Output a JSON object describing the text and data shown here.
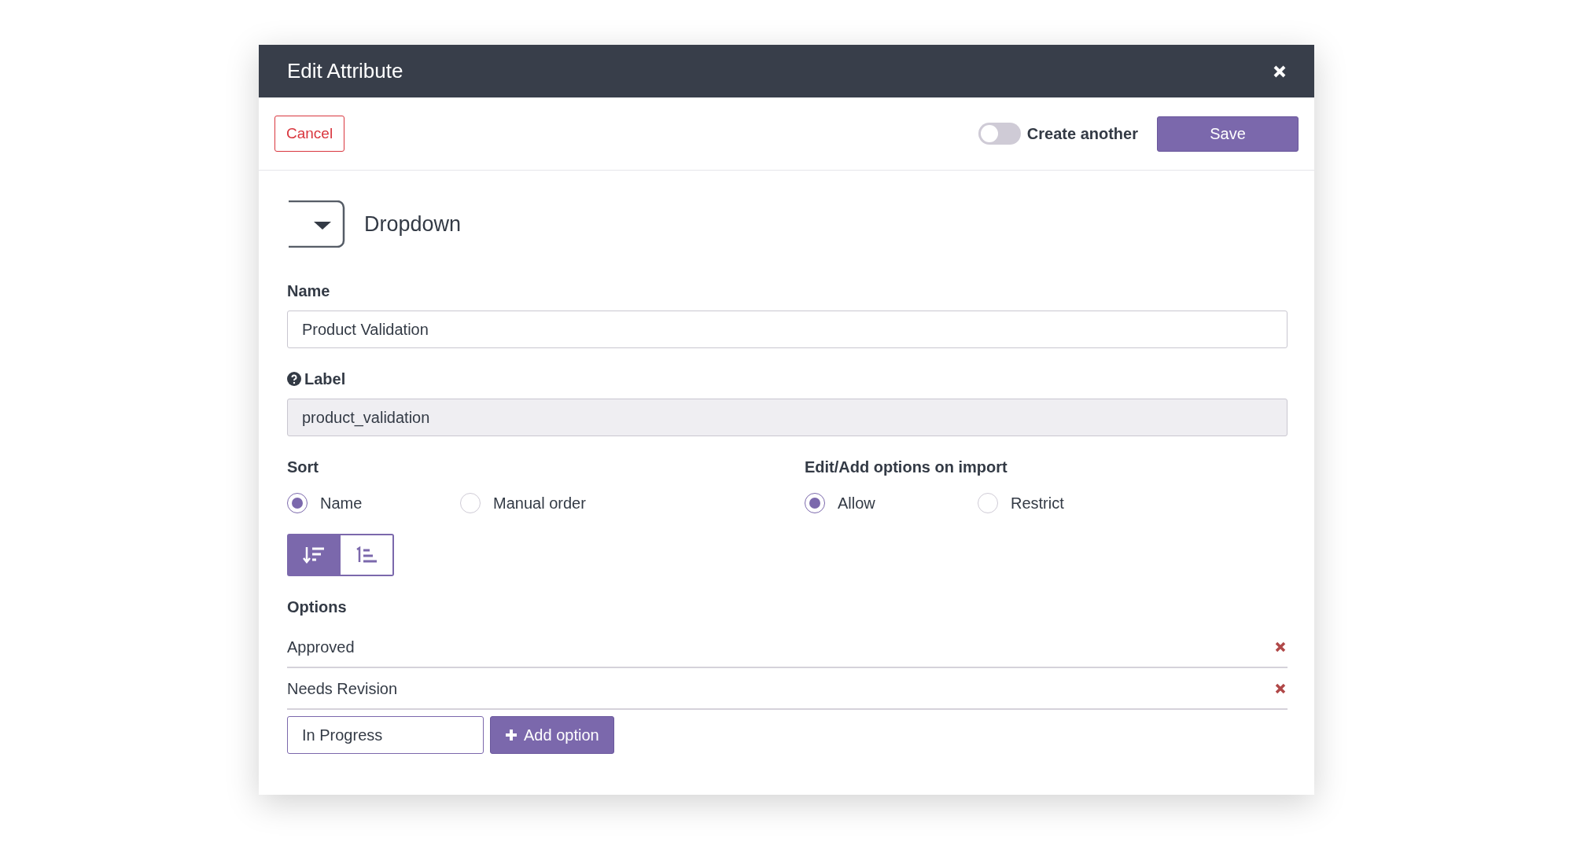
{
  "dialog": {
    "title": "Edit Attribute"
  },
  "toolbar": {
    "cancel": "Cancel",
    "create_another": {
      "label": "Create another",
      "on": false
    },
    "save": "Save"
  },
  "type": {
    "label": "Dropdown"
  },
  "fields": [
    {
      "label": "Name",
      "value": "Product Validation",
      "disabled": false,
      "help": false
    },
    {
      "label": "Label",
      "value": "product_validation",
      "disabled": true,
      "help": true
    }
  ],
  "sort": {
    "heading": "Sort",
    "options": [
      {
        "label": "Name",
        "selected": true
      },
      {
        "label": "Manual order",
        "selected": false
      }
    ],
    "direction": [
      {
        "kind": "descending",
        "selected": true
      },
      {
        "kind": "ascending",
        "selected": false
      }
    ]
  },
  "import": {
    "heading": "Edit/Add options on import",
    "options": [
      {
        "label": "Allow",
        "selected": true
      },
      {
        "label": "Restrict",
        "selected": false
      }
    ]
  },
  "options": {
    "heading": "Options",
    "items": [
      {
        "label": "Approved"
      },
      {
        "label": "Needs Revision"
      }
    ],
    "new_value": "In Progress",
    "add_button": "Add option"
  }
}
